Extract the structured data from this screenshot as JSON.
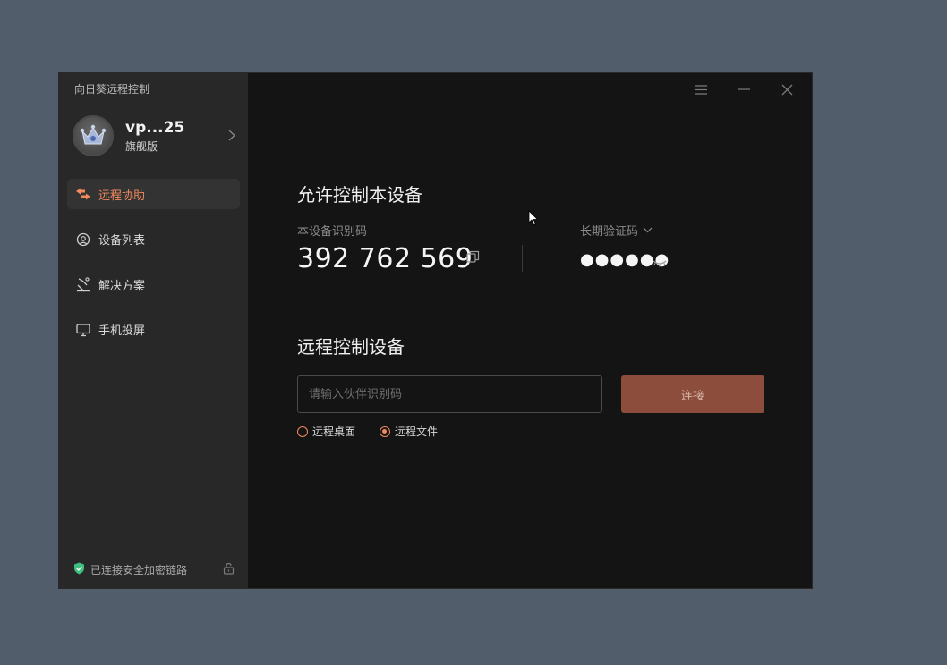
{
  "app": {
    "title": "向日葵远程控制"
  },
  "profile": {
    "name": "vp...25",
    "edition": "旗舰版"
  },
  "sidebar": {
    "items": [
      {
        "label": "远程协助",
        "icon": "remote-assist-icon",
        "active": true
      },
      {
        "label": "设备列表",
        "icon": "device-list-icon",
        "active": false
      },
      {
        "label": "解决方案",
        "icon": "solution-icon",
        "active": false
      },
      {
        "label": "手机投屏",
        "icon": "screen-cast-icon",
        "active": false
      }
    ]
  },
  "footer": {
    "status": "已连接安全加密链路"
  },
  "allow": {
    "title": "允许控制本设备",
    "device_id_label": "本设备识别码",
    "device_id": "392 762 569",
    "password_label": "长期验证码",
    "password_masked": "●●●●●●"
  },
  "remote": {
    "title": "远程控制设备",
    "input_placeholder": "请输入伙伴识别码",
    "connect_label": "连接",
    "modes": [
      {
        "label": "远程桌面",
        "selected": false
      },
      {
        "label": "远程文件",
        "selected": true
      }
    ]
  },
  "colors": {
    "accent": "#f08a5d",
    "button": "#8c4d3c",
    "sidebar": "#282828",
    "content": "#141414",
    "desktop": "#515d6b"
  }
}
